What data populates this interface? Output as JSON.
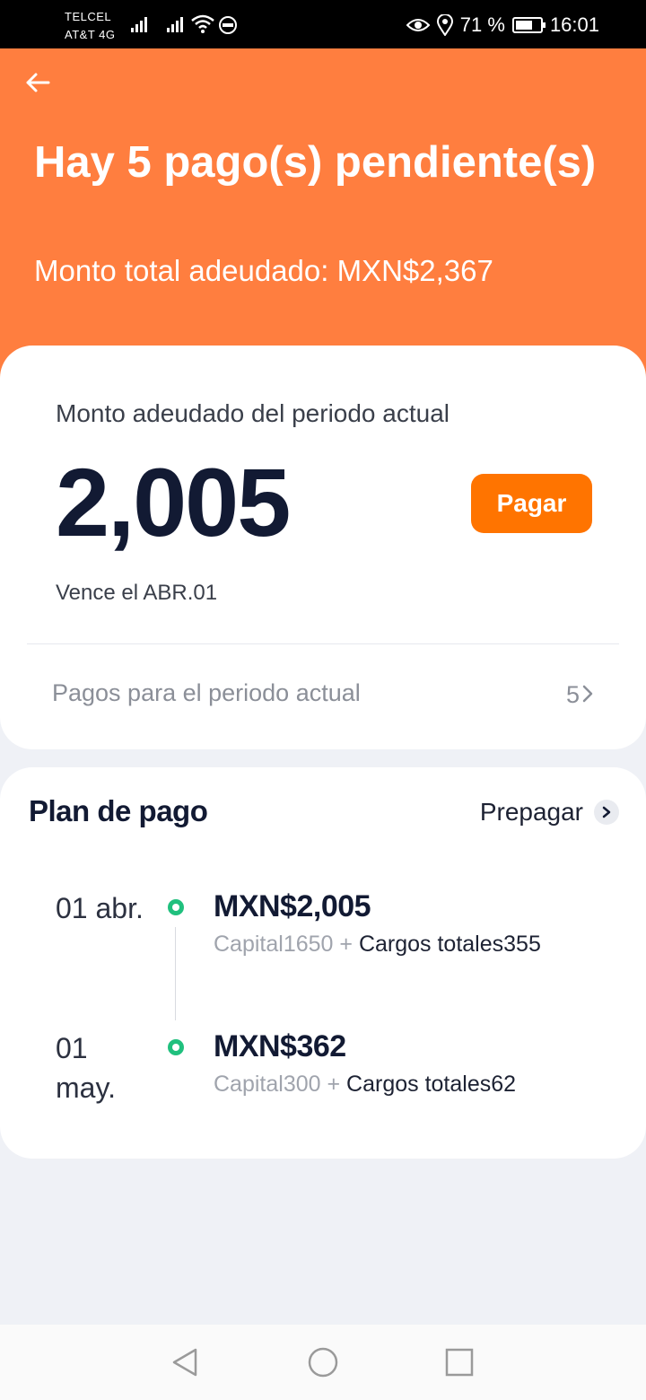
{
  "status_bar": {
    "carrier1": "TELCEL",
    "carrier2": "AT&T 4G",
    "battery_percent": "71 %",
    "time": "16:01"
  },
  "header": {
    "title": "Hay 5 pago(s) pendiente(s)",
    "subtitle": "Monto total adeudado: MXN$2,367",
    "background_color": "#ff7e3f"
  },
  "current_period": {
    "label": "Monto adeudado del periodo actual",
    "amount": "2,005",
    "pay_button": "Pagar",
    "due_date": "Vence el ABR.01",
    "payments_row_label": "Pagos para el periodo actual",
    "payments_count": "5",
    "accent_color": "#ff7400"
  },
  "plan": {
    "title": "Plan de pago",
    "prepay_label": "Prepagar",
    "items": [
      {
        "date": "01 abr.",
        "amount": "MXN$2,005",
        "capital": "Capital1650",
        "separator": " + ",
        "charges": "Cargos totales355"
      },
      {
        "date": "01 may.",
        "amount": "MXN$362",
        "capital": "Capital300",
        "separator": " + ",
        "charges": "Cargos totales62"
      }
    ]
  },
  "icons": {
    "back": "arrow-left-icon",
    "chevron": "chevron-right-icon",
    "nav_back": "triangle-back-icon",
    "nav_home": "circle-home-icon",
    "nav_recents": "square-recents-icon"
  }
}
